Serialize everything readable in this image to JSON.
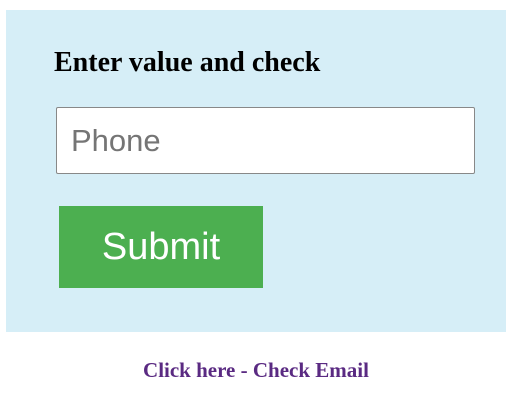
{
  "form": {
    "heading": "Enter value and check",
    "phone_placeholder": "Phone",
    "phone_value": "",
    "submit_label": "Submit"
  },
  "footer": {
    "link_text": "Click here - Check Email"
  },
  "colors": {
    "panel_background": "#d6eef7",
    "submit_background": "#4caf50",
    "submit_text": "#ffffff",
    "link_color": "#5a2a82"
  }
}
